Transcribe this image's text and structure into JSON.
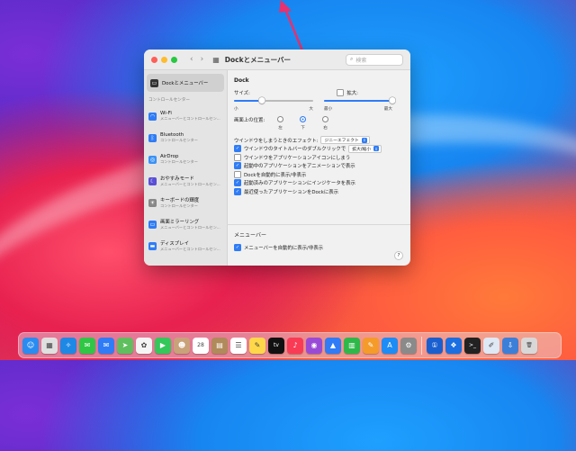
{
  "window": {
    "title": "Dockとメニューバー",
    "search_placeholder": "検索",
    "nav_back": "‹",
    "nav_forward": "›",
    "grid_icon": "grid-icon"
  },
  "sidebar": {
    "selected": {
      "label": "Dockとメニューバー",
      "icon": "dock-icon"
    },
    "section": "コントロールセンター",
    "items": [
      {
        "name": "Wi-Fi",
        "sub": "メニューバーとコントロールセン...",
        "icon": "wifi-icon",
        "color": "#2f7cf6",
        "glyph": "◠"
      },
      {
        "name": "Bluetooth",
        "sub": "コントロールセンター",
        "icon": "bluetooth-icon",
        "color": "#2f7cf6",
        "glyph": "ᛒ"
      },
      {
        "name": "AirDrop",
        "sub": "コントロールセンター",
        "icon": "airdrop-icon",
        "color": "#3a92f8",
        "glyph": "◎"
      },
      {
        "name": "おやすみモード",
        "sub": "メニューバーとコントロールセン...",
        "icon": "moon-icon",
        "color": "#5a4fd6",
        "glyph": "☾"
      },
      {
        "name": "キーボードの輝度",
        "sub": "コントロールセンター",
        "icon": "keyboard-brightness-icon",
        "color": "#888888",
        "glyph": "☀"
      },
      {
        "name": "画面ミラーリング",
        "sub": "メニューバーとコントロールセン...",
        "icon": "screen-mirroring-icon",
        "color": "#2f7cf6",
        "glyph": "▭"
      },
      {
        "name": "ディスプレイ",
        "sub": "メニューバーとコントロールセン...",
        "icon": "display-icon",
        "color": "#2f7cf6",
        "glyph": "▬"
      }
    ]
  },
  "dock_section": {
    "title": "Dock",
    "size_label": "サイズ:",
    "size_small": "小",
    "size_large": "大",
    "size_value": 0.35,
    "magnify_label": "拡大:",
    "magnify_min": "最小",
    "magnify_max": "最大",
    "magnify_value": 1.0,
    "position_label": "画面上の位置:",
    "position_left": "左",
    "position_bottom": "下",
    "position_right": "右",
    "minimize_label": "ウインドウをしまうときのエフェクト:",
    "minimize_value": "ジニーエフェクト",
    "double_click_label": "ウインドウのタイトルバーのダブルクリックで",
    "double_click_value": "拡大/縮小",
    "options": [
      {
        "label": "ウインドウをアプリケーションアイコンにしまう",
        "checked": false
      },
      {
        "label": "起動中のアプリケーションをアニメーションで表示",
        "checked": true
      },
      {
        "label": "Dockを自動的に表示/非表示",
        "checked": false
      },
      {
        "label": "起動済みのアプリケーションにインジケータを表示",
        "checked": true
      },
      {
        "label": "最近使ったアプリケーションをDockに表示",
        "checked": true
      }
    ]
  },
  "menubar_section": {
    "title": "メニューバー",
    "option": "メニューバーを自動的に表示/非表示",
    "help": "?"
  },
  "dock": {
    "apps": [
      {
        "icon": "finder-icon",
        "color": "#2a8cf0",
        "glyph": "☺"
      },
      {
        "icon": "launchpad-icon",
        "color": "#e0e0e0",
        "glyph": "▦"
      },
      {
        "icon": "safari-icon",
        "color": "#1e88e5",
        "glyph": "✧"
      },
      {
        "icon": "messages-icon",
        "color": "#2fc745",
        "glyph": "✉"
      },
      {
        "icon": "mail-icon",
        "color": "#2f7cf6",
        "glyph": "✉"
      },
      {
        "icon": "maps-icon",
        "color": "#5fbf5f",
        "glyph": "➤"
      },
      {
        "icon": "photos-icon",
        "color": "#f5f5f5",
        "glyph": "✿"
      },
      {
        "icon": "facetime-icon",
        "color": "#34c759",
        "glyph": "▶"
      },
      {
        "icon": "contacts-icon",
        "color": "#c9a27a",
        "glyph": "☻"
      },
      {
        "icon": "calendar-icon",
        "color": "#ffffff",
        "glyph": "28"
      },
      {
        "icon": "contacts-book-icon",
        "color": "#b08a5a",
        "glyph": "▤"
      },
      {
        "icon": "reminders-icon",
        "color": "#ffffff",
        "glyph": "☰"
      },
      {
        "icon": "notes-icon",
        "color": "#ffd84a",
        "glyph": "✎"
      },
      {
        "icon": "appletv-icon",
        "color": "#111111",
        "glyph": "tv"
      },
      {
        "icon": "music-icon",
        "color": "#fa3b55",
        "glyph": "♪"
      },
      {
        "icon": "podcasts-icon",
        "color": "#9a4bd6",
        "glyph": "◉"
      },
      {
        "icon": "keynote-icon",
        "color": "#2f7cf6",
        "glyph": "▲"
      },
      {
        "icon": "numbers-icon",
        "color": "#2fb84a",
        "glyph": "▥"
      },
      {
        "icon": "pages-icon",
        "color": "#f59b2a",
        "glyph": "✎"
      },
      {
        "icon": "appstore-icon",
        "color": "#1e8cf5",
        "glyph": "A"
      },
      {
        "icon": "system-preferences-icon",
        "color": "#8a8a8a",
        "glyph": "⚙"
      },
      {
        "icon": "separator",
        "color": "",
        "glyph": ""
      },
      {
        "icon": "onepassword-icon",
        "color": "#1a5fcf",
        "glyph": "①"
      },
      {
        "icon": "dropbox-icon",
        "color": "#1b6fe0",
        "glyph": "❖"
      },
      {
        "icon": "terminal-icon",
        "color": "#222222",
        "glyph": ">_"
      },
      {
        "icon": "preview-icon",
        "color": "#dfe8f5",
        "glyph": "✐"
      },
      {
        "icon": "downloads-icon",
        "color": "#3c7fd9",
        "glyph": "⇩"
      },
      {
        "icon": "trash-icon",
        "color": "#d8d8d8",
        "glyph": "🗑"
      }
    ]
  }
}
